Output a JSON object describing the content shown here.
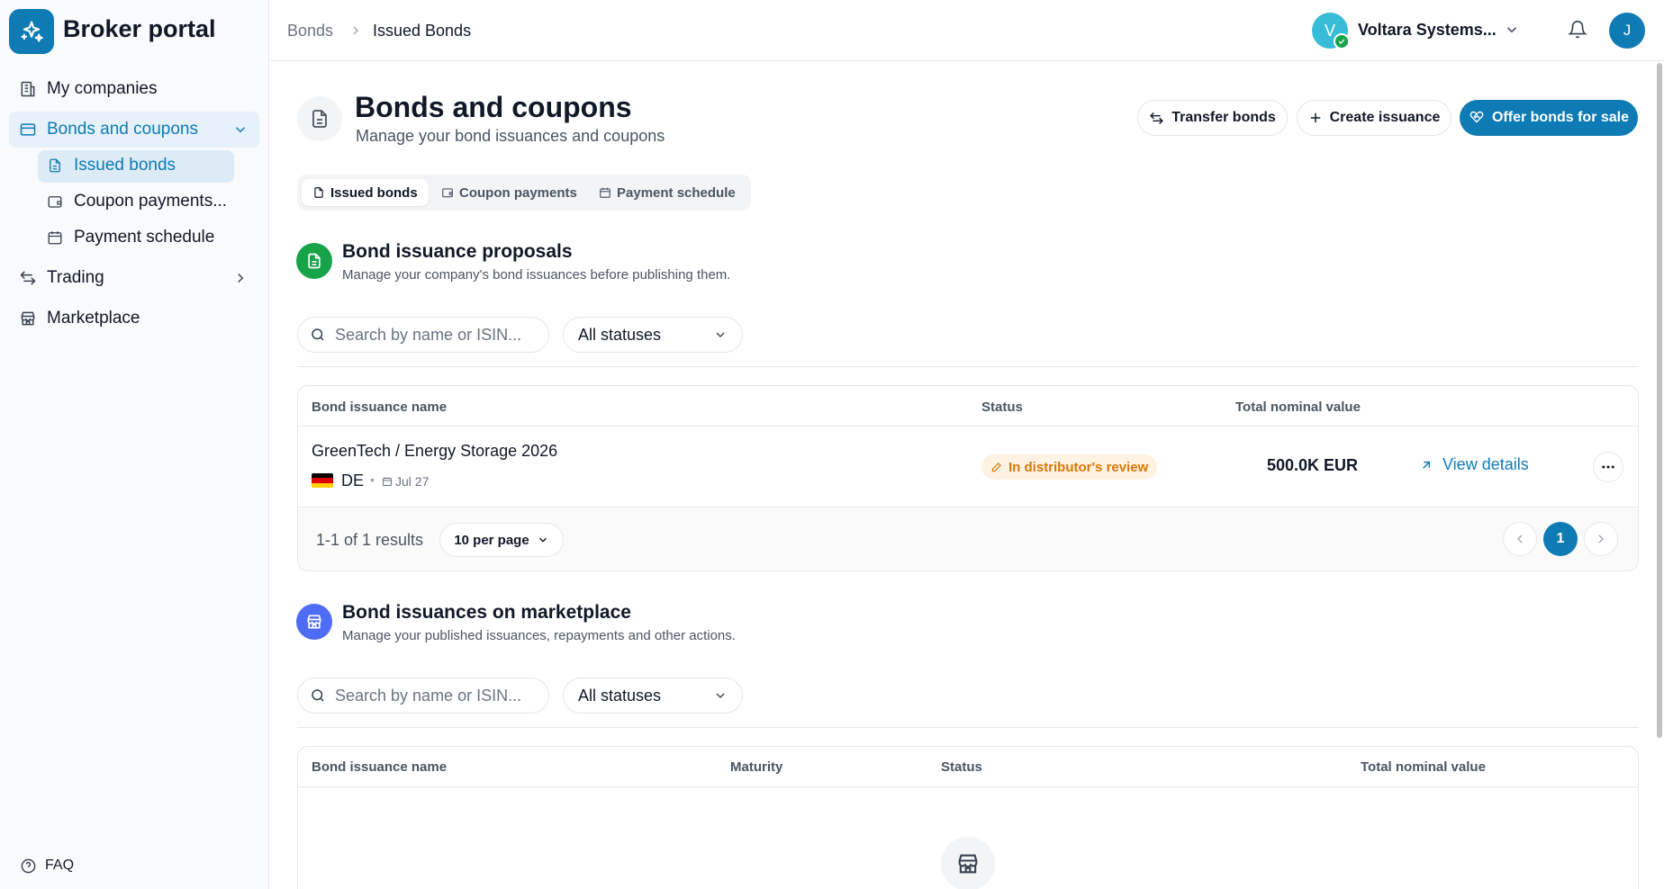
{
  "app": {
    "brand": "Broker portal"
  },
  "sidebar": {
    "items": [
      {
        "label": "My companies"
      },
      {
        "label": "Bonds and coupons"
      },
      {
        "label": "Issued bonds"
      },
      {
        "label": "Coupon payments..."
      },
      {
        "label": "Payment schedule"
      },
      {
        "label": "Trading"
      },
      {
        "label": "Marketplace"
      }
    ],
    "faq": "FAQ"
  },
  "header": {
    "breadcrumb": [
      "Bonds",
      "Issued Bonds"
    ],
    "company_initial": "V",
    "company_name": "Voltara Systems...",
    "user_initial": "J"
  },
  "page": {
    "title": "Bonds and coupons",
    "subtitle": "Manage your bond issuances and coupons",
    "actions": {
      "transfer": "Transfer bonds",
      "create": "Create issuance",
      "offer": "Offer bonds for sale"
    },
    "tabs": [
      {
        "label": "Issued bonds"
      },
      {
        "label": "Coupon payments"
      },
      {
        "label": "Payment schedule"
      }
    ]
  },
  "proposals": {
    "title": "Bond issuance proposals",
    "subtitle": "Manage your company's bond issuances before publishing them.",
    "search_placeholder": "Search by name or ISIN...",
    "status_filter": "All statuses",
    "columns": [
      "Bond issuance name",
      "Status",
      "Total nominal value"
    ],
    "rows": [
      {
        "name": "GreenTech / Energy Storage 2026",
        "country": "DE",
        "date": "Jul 27",
        "status": "In distributor's review",
        "value": "500.0K EUR",
        "action": "View details"
      }
    ],
    "results": "1-1 of 1 results",
    "per_page": "10 per page",
    "current_page": "1"
  },
  "marketplace": {
    "title": "Bond issuances on marketplace",
    "subtitle": "Manage your published issuances, repayments and other actions.",
    "search_placeholder": "Search by name or ISIN...",
    "status_filter": "All statuses",
    "columns": [
      "Bond issuance name",
      "Maturity",
      "Status",
      "Total nominal value"
    ]
  },
  "colors": {
    "accent": "#0e7bb5",
    "green": "#16a34a",
    "indigo": "#4f6cf7",
    "warning": "#d97706"
  }
}
